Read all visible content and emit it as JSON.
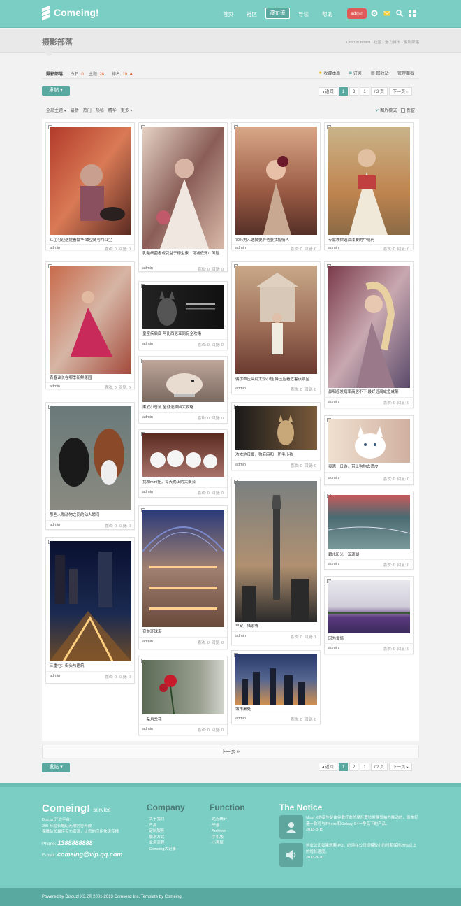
{
  "header": {
    "logo_text": "Comeing!",
    "nav": [
      "首页",
      "社区",
      "瀑布流",
      "导读",
      "帮助"
    ],
    "active_nav": "瀑布流",
    "user": "admin"
  },
  "title": {
    "text": "摄影部落",
    "breadcrumb": [
      "Discuz! Board",
      "社区",
      "魅力城市",
      "摄影部落"
    ]
  },
  "forum": {
    "name": "摄影部落",
    "today_label": "今日:",
    "today_val": "0",
    "topics_label": "主题:",
    "topics_val": "28",
    "rank_label": "排名:",
    "rank_val": "19",
    "tools": [
      "收藏本版",
      "订阅",
      "回收站",
      "管理面板"
    ]
  },
  "toolbar": {
    "post_label": "发帖 ▾",
    "pager_back": "◂ 返回",
    "pages": [
      "1",
      "2"
    ],
    "current_page": "1",
    "page_total": "/ 2 页",
    "next_label": "下一页 ▸"
  },
  "filter": {
    "items": [
      "全部主题 ▾",
      "最新",
      "热门",
      "热帖",
      "精华",
      "更多 ▾"
    ],
    "view_items": [
      "图片模式",
      "新窗"
    ]
  },
  "cards": [
    {
      "title": "红尘可迎送提看繁华 致空随与月红尘",
      "author": "admin",
      "likes": "喜欢: 0",
      "replies": "回复: 0"
    },
    {
      "title": "青春谁长在哪季新鲜原园",
      "author": "admin",
      "likes": "喜欢: 0",
      "replies": "回复: 0"
    },
    {
      "title": "那些人和动物之间的动人瞬间",
      "author": "admin",
      "likes": "喜欢: 0",
      "replies": "回复: 0"
    },
    {
      "title": "三重屯：街头与建筑",
      "author": "admin",
      "likes": "喜欢: 0",
      "replies": "回复: 0"
    },
    {
      "title": "乳酸细菌者或受益于德生素C 可减低死亡风险",
      "author": "admin",
      "likes": "喜欢: 0",
      "replies": "回复: 0"
    },
    {
      "title": "皇室疾后裔 阿比西尼亚同有全攻略",
      "author": "admin",
      "likes": "喜欢: 0",
      "replies": "回复: 0"
    },
    {
      "title": "柔软小仓鼠 全就选购四大攻略",
      "author": "admin",
      "likes": "喜欢: 0",
      "replies": "回复: 0"
    },
    {
      "title": "我和mini狂，每天晚上的大聚会",
      "author": "admin",
      "likes": "喜欢: 0",
      "replies": "回复: 0"
    },
    {
      "title": "夜游环球港",
      "author": "admin",
      "likes": "喜欢: 0",
      "replies": "回复: 0"
    },
    {
      "title": "一朵月季花",
      "author": "admin",
      "likes": "喜欢: 0",
      "replies": "回复: 0"
    },
    {
      "title": "70%男人选择要胖老婆找瘦情人",
      "author": "admin",
      "likes": "喜欢: 0",
      "replies": "回复: 0"
    },
    {
      "title": "偶尔血压高别太惊小怪 降压应看危害该项区",
      "author": "admin",
      "likes": "喜欢: 0",
      "replies": "回复: 0"
    },
    {
      "title": "浓浓地母爱，狗麻麻和一团毛小孩",
      "author": "admin",
      "likes": "喜欢: 0",
      "replies": "回复: 0"
    },
    {
      "title": "早安，陆家嘴",
      "author": "admin",
      "likes": "喜欢: 0",
      "replies": "回复: 1"
    },
    {
      "title": "城市黑处",
      "author": "admin",
      "likes": "喜欢: 0",
      "replies": "回复: 0"
    },
    {
      "title": "专家教你选油漆要的中成药",
      "author": "admin",
      "likes": "喜欢: 0",
      "replies": "回复: 0"
    },
    {
      "title": "鼻咽癌发病率高居不下 最好远离咸鱼咸菜",
      "author": "admin",
      "likes": "喜欢: 0",
      "replies": "回复: 0"
    },
    {
      "title": "泰晤一日游，带上狗狗去晒皮",
      "author": "admin",
      "likes": "喜欢: 0",
      "replies": "回复: 0"
    },
    {
      "title": "碧水阳光一汉源湖",
      "author": "admin",
      "likes": "喜欢: 0",
      "replies": "回复: 0"
    },
    {
      "title": "因为爱情",
      "author": "admin",
      "likes": "喜欢: 0",
      "replies": "回复: 0"
    }
  ],
  "bottom": {
    "next_page": "下一页 »"
  },
  "footer": {
    "brand": "Comeing!",
    "brand_sub": "service",
    "desc": [
      "Discuz!开放平台:",
      "200 万站长酷幻无限内容开放",
      "保障站长最佳有力资源，让您的应用快速传播"
    ],
    "phone_label": "Phone:",
    "phone": "1388888888",
    "email_label": "E-mail:",
    "email": "comeing@vip.qq.com",
    "company_title": "Company",
    "company_links": [
      "关于我们",
      "产品",
      "定制服务",
      "联系方式",
      "业务流程",
      "Comeing大记事"
    ],
    "function_title": "Function",
    "function_links": [
      "站点统计",
      "举报",
      "Archiver",
      "手机版",
      "小黑屋"
    ],
    "notice_title": "The Notice",
    "notices": [
      {
        "text": "Moto X的诞生是由谷歌任命的摩托罗拉发展领袖力推动的，原本打造一款可与iPhone和Galaxy S4一争高下的产品。",
        "date": "2013-3-15"
      },
      {
        "text": "创业公司如果想要IPO，必须在公司规模较小的时期保持20%以上的增长速度。",
        "date": "2013-8-20"
      }
    ],
    "copyright": "Powered by Discuz! X3.2© 2001-2013 Comsenz Inc. Template by Comeing"
  }
}
